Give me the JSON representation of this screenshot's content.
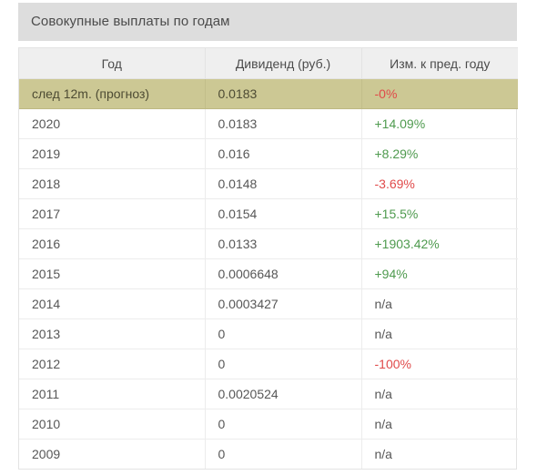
{
  "panel": {
    "title": "Совокупные выплаты по годам"
  },
  "table": {
    "columns": [
      {
        "key": "year",
        "label": "Год"
      },
      {
        "key": "div",
        "label": "Дивиденд (руб.)"
      },
      {
        "key": "change",
        "label": "Изм. к пред. году"
      }
    ],
    "rows": [
      {
        "year": "след 12m. (прогноз)",
        "div": "0.0183",
        "change": "-0%",
        "change_dir": "down",
        "highlight": true
      },
      {
        "year": "2020",
        "div": "0.0183",
        "change": "+14.09%",
        "change_dir": "up",
        "highlight": false
      },
      {
        "year": "2019",
        "div": "0.016",
        "change": "+8.29%",
        "change_dir": "up",
        "highlight": false
      },
      {
        "year": "2018",
        "div": "0.0148",
        "change": "-3.69%",
        "change_dir": "down",
        "highlight": false
      },
      {
        "year": "2017",
        "div": "0.0154",
        "change": "+15.5%",
        "change_dir": "up",
        "highlight": false
      },
      {
        "year": "2016",
        "div": "0.0133",
        "change": "+1903.42%",
        "change_dir": "up",
        "highlight": false
      },
      {
        "year": "2015",
        "div": "0.0006648",
        "change": "+94%",
        "change_dir": "up",
        "highlight": false
      },
      {
        "year": "2014",
        "div": "0.0003427",
        "change": "n/a",
        "change_dir": "na",
        "highlight": false
      },
      {
        "year": "2013",
        "div": "0",
        "change": "n/a",
        "change_dir": "na",
        "highlight": false
      },
      {
        "year": "2012",
        "div": "0",
        "change": "-100%",
        "change_dir": "down",
        "highlight": false
      },
      {
        "year": "2011",
        "div": "0.0020524",
        "change": "n/a",
        "change_dir": "na",
        "highlight": false
      },
      {
        "year": "2010",
        "div": "0",
        "change": "n/a",
        "change_dir": "na",
        "highlight": false
      },
      {
        "year": "2009",
        "div": "0",
        "change": "n/a",
        "change_dir": "na",
        "highlight": false
      }
    ]
  },
  "colors": {
    "title_bar_bg": "#dddddd",
    "header_bg": "#efefef",
    "highlight_row_bg": "#ccc894",
    "positive": "#4e9a4e",
    "negative": "#e04a4a",
    "text": "#575757"
  }
}
